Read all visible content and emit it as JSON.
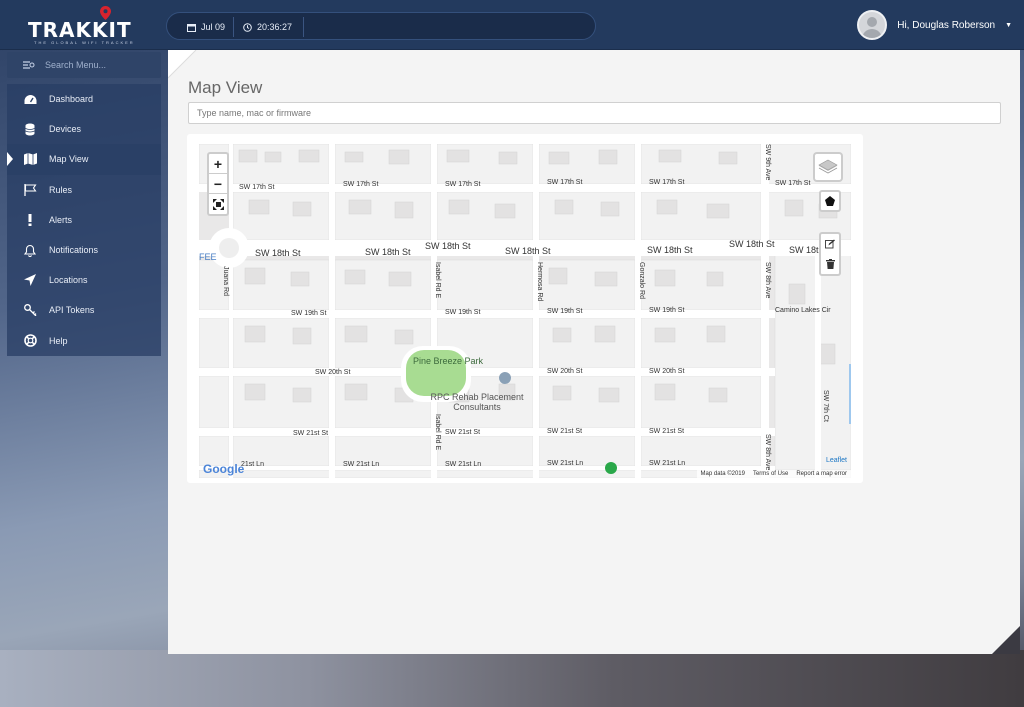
{
  "brand": {
    "name": "TRAKKIT",
    "tagline": "THE GLOBAL WIFI TRACKER"
  },
  "header": {
    "date": "Jul 09",
    "time": "20:36:27",
    "user_greeting": "Hi, Douglas Roberson"
  },
  "sidebar": {
    "search_placeholder": "Search Menu...",
    "items": [
      {
        "label": "Dashboard",
        "icon": "dashboard-icon"
      },
      {
        "label": "Devices",
        "icon": "devices-icon"
      },
      {
        "label": "Map View",
        "icon": "map-icon",
        "active": true
      },
      {
        "label": "Rules",
        "icon": "flag-icon"
      },
      {
        "label": "Alerts",
        "icon": "exclamation-icon"
      },
      {
        "label": "Notifications",
        "icon": "bell-icon"
      },
      {
        "label": "Locations",
        "icon": "location-arrow-icon"
      },
      {
        "label": "API Tokens",
        "icon": "key-icon"
      },
      {
        "label": "Help",
        "icon": "lifebuoy-icon"
      }
    ]
  },
  "main": {
    "title": "Map View",
    "filter_placeholder": "Type name, mac or firmware"
  },
  "map": {
    "streets": {
      "s17": "SW 17th St",
      "s18": "SW 18th St",
      "s18b": "SW 18th",
      "s19": "SW 19th St",
      "s20": "SW 20th St",
      "s21": "SW 21st St",
      "s21b": "SW 21st St",
      "s21ln": "SW 21st Ln",
      "s21lnb": "21st Ln",
      "isabel": "Isabel Rd E",
      "hermosa": "Hermosa Rd",
      "gonzalo": "Gonzalo Rd",
      "ave9": "SW 9th Ave",
      "ave8": "SW 8th Ave",
      "ct7": "SW 7th Ct",
      "camino": "Camino Lakes Cir",
      "juana": "Juana Rd",
      "fee": "FEE"
    },
    "park": "Pine Breeze Park",
    "business": "RPC Rehab Placement Consultants",
    "leaflet": "Leaflet",
    "google": "Google",
    "attribution": {
      "data": "Map data ©2019",
      "terms": "Terms of Use",
      "report": "Report a map error"
    },
    "zoom_in": "+",
    "zoom_out": "−"
  },
  "colors": {
    "header": "#233a5e",
    "sidebar": "#2a4066",
    "panel": "#f4f4f4",
    "accent_pin": "#d9232d"
  }
}
